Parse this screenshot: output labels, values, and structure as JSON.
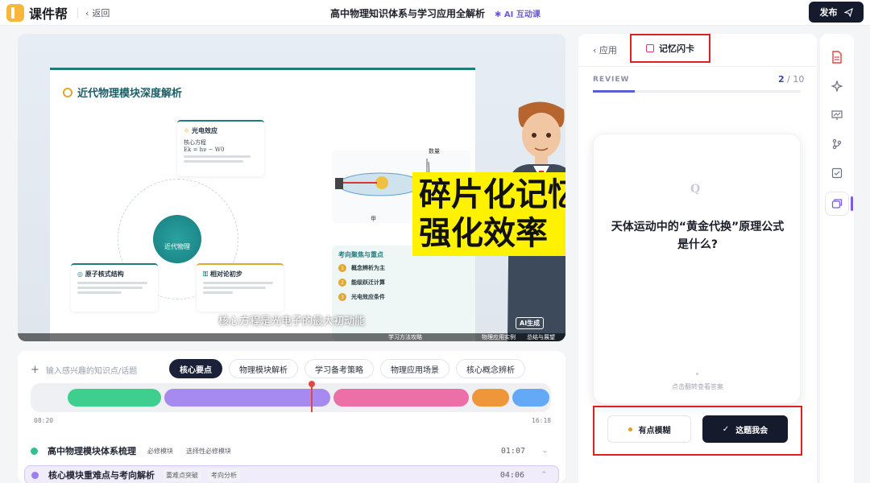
{
  "app": {
    "logo_text": "课件帮",
    "back_label": "返回",
    "title": "高中物理知识体系与学习应用全解析",
    "ai_tag": "AI 互动课",
    "publish_label": "发布"
  },
  "slide": {
    "title": "近代物理模块深度解析",
    "center_node": "近代物理",
    "card_photoelectric": "光电效应",
    "card_photoelectric_line1": "核心方程",
    "card_photoelectric_formula": "Ek = hν − W0",
    "card_nucleus": "原子核式结构",
    "card_relativity": "相对论初步",
    "diagram_label": "甲",
    "diagram_ylabel": "数量",
    "focus_title": "考向聚焦与重点",
    "focus_items": [
      "概念辨析为主",
      "能级跃迁计算",
      "光电效应条件"
    ],
    "overlay_line1": "碎片化记忆",
    "overlay_line2": "强化效率",
    "subtitle": "核心方程是光电子的最大初动能",
    "ai_badge": "AI生成",
    "chapters": [
      "学习方法攻略",
      "物理应用实例",
      "总结与展望"
    ]
  },
  "timeline": {
    "search_placeholder": "输入感兴趣的知识点/话题",
    "tags": [
      "核心要点",
      "物理模块解析",
      "学习备考策略",
      "物理应用场景",
      "核心概念辨析"
    ],
    "time_start": "08:20",
    "time_end": "16:18",
    "segments": [
      {
        "name": "segment-1",
        "color": "#3ecf8e"
      },
      {
        "name": "segment-2",
        "color": "#a68af0"
      },
      {
        "name": "segment-3",
        "color": "#ec6fa8"
      },
      {
        "name": "segment-4",
        "color": "#f0963a"
      },
      {
        "name": "segment-5",
        "color": "#64a9f5"
      }
    ],
    "rows": [
      {
        "title": "高中物理模块体系梳理",
        "tags": [
          "必修模块",
          "选择性必修模块"
        ],
        "time": "01:07",
        "dot": "#34c08a"
      },
      {
        "title": "核心模块重难点与考向解析",
        "tags": [
          "重难点突破",
          "考向分析"
        ],
        "time": "04:06",
        "dot": "#9b7ff0"
      }
    ]
  },
  "flashcard": {
    "back_label": "应用",
    "tab_label": "记忆闪卡",
    "review_label": "REVIEW",
    "current": "2",
    "total": "10",
    "progress": 0.2,
    "q_badge": "Q",
    "question": "天体运动中的“黄金代换”原理公式是什么?",
    "hint": "点击翻转查看答案",
    "btn_fuzzy": "有点模糊",
    "btn_know": "这题我会"
  },
  "colors": {
    "accent": "#151a2d",
    "highlight_frame": "#e02020",
    "overlay_bg": "#fff200"
  }
}
